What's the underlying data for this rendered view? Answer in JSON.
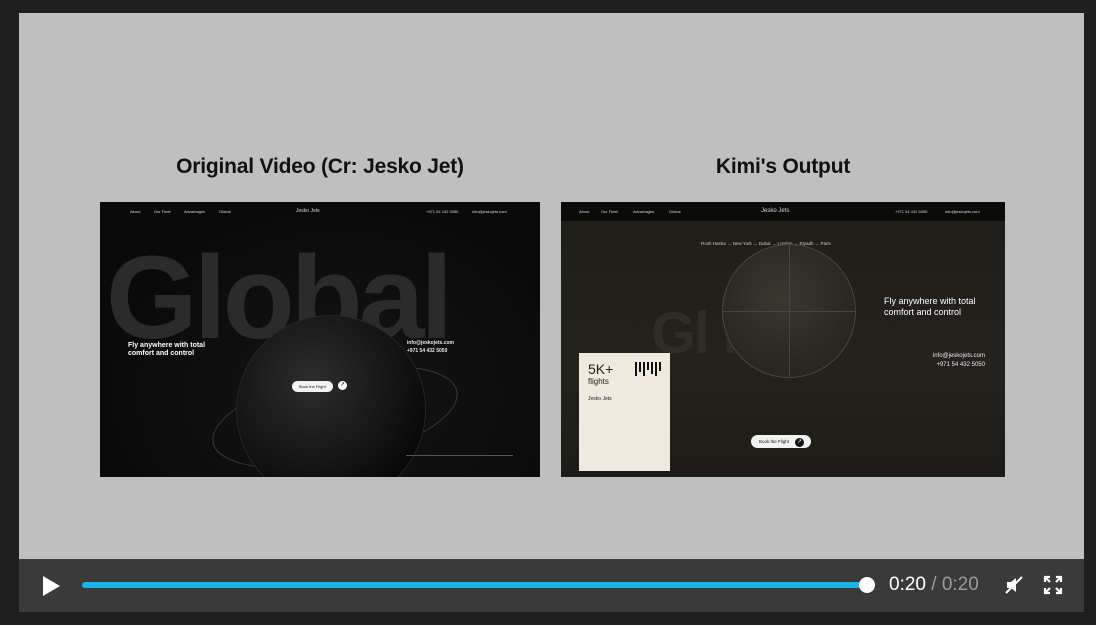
{
  "titles": {
    "left": "Original Video (Cr: Jesko Jet)",
    "right": "Kimi's Output"
  },
  "left_shot": {
    "nav": [
      "About",
      "Our Fleet",
      "Advantages",
      "Global"
    ],
    "brand": "Jesko Jets",
    "nav_phone": "+971 54 432 5050",
    "nav_email": "info@jeskojets.com",
    "big_word": "Global",
    "headline": "Fly anywhere with total comfort and control",
    "contact_email": "info@jeskojets.com",
    "contact_phone": "+971 54 432 5050",
    "button": "Book the Flight"
  },
  "right_shot": {
    "nav": [
      "About",
      "Our Fleet",
      "Advantages",
      "Global"
    ],
    "brand": "Jesko Jets",
    "nav_phone": "+971 54 432 5050",
    "nav_email": "info@jeskojets.com",
    "cities": "Rosh Hasha  →  New York  →  Dubai  →  London  →  Riyadh  →  Paris",
    "big_word": "Gl   bal",
    "headline": "Fly anywhere with total comfort and control",
    "contact_email": "info@jeskojets.com",
    "contact_phone": "+971 54 432 5050",
    "button": "Book the Flight",
    "card": {
      "big": "5K+",
      "unit": "flights",
      "brand": "Jesko Jets"
    }
  },
  "player": {
    "current": "0:20",
    "separator": "/",
    "duration": "0:20",
    "progress": 1.0,
    "accent": "#1ab3e8"
  },
  "icons": [
    "play-icon",
    "mute-icon",
    "fullscreen-icon"
  ]
}
